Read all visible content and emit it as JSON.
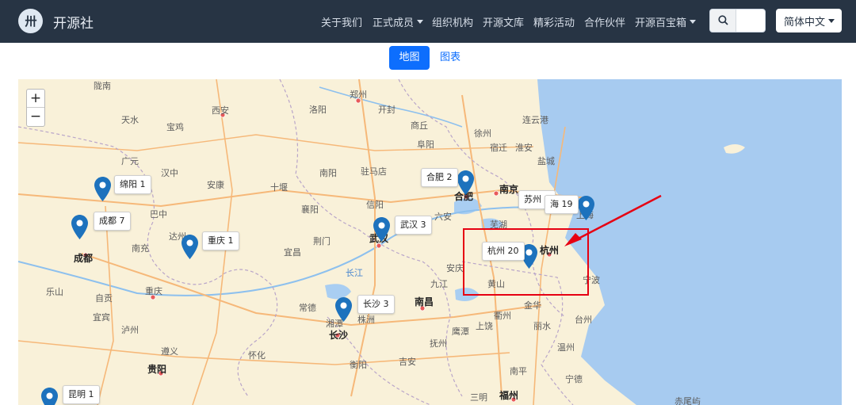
{
  "header": {
    "brand": "开源社",
    "nav": [
      {
        "label": "关于我们",
        "dropdown": false
      },
      {
        "label": "正式成员",
        "dropdown": true
      },
      {
        "label": "组织机构",
        "dropdown": false
      },
      {
        "label": "开源文库",
        "dropdown": false
      },
      {
        "label": "精彩活动",
        "dropdown": false
      },
      {
        "label": "合作伙伴",
        "dropdown": false
      },
      {
        "label": "开源百宝箱",
        "dropdown": true
      }
    ],
    "search_icon": "search-icon",
    "search_value": "",
    "language": "简体中文"
  },
  "tabs": {
    "map": "地图",
    "chart": "图表",
    "active": "地图"
  },
  "map": {
    "zoom_in": "+",
    "zoom_out": "−",
    "colors": {
      "land": "#f9f1d9",
      "sea": "#a7cbf0",
      "marker": "#1d72bd",
      "annotation": "#e60012"
    },
    "place_labels": [
      {
        "text": "西安",
        "major": false
      },
      {
        "text": "郑州",
        "major": false
      },
      {
        "text": "成都",
        "major": true
      },
      {
        "text": "重庆",
        "major": false
      },
      {
        "text": "武汉",
        "major": true
      },
      {
        "text": "合肥",
        "major": true
      },
      {
        "text": "南京",
        "major": true
      },
      {
        "text": "杭州",
        "major": true
      },
      {
        "text": "南昌",
        "major": true
      },
      {
        "text": "长沙",
        "major": true
      },
      {
        "text": "贵阳",
        "major": true
      },
      {
        "text": "福州",
        "major": true
      },
      {
        "text": "上海",
        "major": false
      },
      {
        "text": "长江",
        "major": false
      },
      {
        "text": "天水",
        "major": false
      },
      {
        "text": "宝鸡",
        "major": false
      },
      {
        "text": "汉中",
        "major": false
      },
      {
        "text": "安康",
        "major": false
      },
      {
        "text": "十堰",
        "major": false
      },
      {
        "text": "襄阳",
        "major": false
      },
      {
        "text": "信阳",
        "major": false
      },
      {
        "text": "荆门",
        "major": false
      },
      {
        "text": "宜昌",
        "major": false
      },
      {
        "text": "岳阳",
        "major": false
      },
      {
        "text": "常德",
        "major": false
      },
      {
        "text": "九江",
        "major": false
      },
      {
        "text": "安庆",
        "major": false
      },
      {
        "text": "芜湖",
        "major": false
      },
      {
        "text": "徐州",
        "major": false
      },
      {
        "text": "连云港",
        "major": false
      },
      {
        "text": "宿迁",
        "major": false
      },
      {
        "text": "淮安",
        "major": false
      },
      {
        "text": "盐城",
        "major": false
      },
      {
        "text": "阜阳",
        "major": false
      },
      {
        "text": "商丘",
        "major": false
      },
      {
        "text": "开封",
        "major": false
      },
      {
        "text": "洛阳",
        "major": false
      },
      {
        "text": "南阳",
        "major": false
      },
      {
        "text": "驻马店",
        "major": false
      },
      {
        "text": "六安",
        "major": false
      },
      {
        "text": "黄山",
        "major": false
      },
      {
        "text": "宁波",
        "major": false
      },
      {
        "text": "台州",
        "major": false
      },
      {
        "text": "温州",
        "major": false
      },
      {
        "text": "丽水",
        "major": false
      },
      {
        "text": "金华",
        "major": false
      },
      {
        "text": "衢州",
        "major": false
      },
      {
        "text": "上饶",
        "major": false
      },
      {
        "text": "鹰潭",
        "major": false
      },
      {
        "text": "抚州",
        "major": false
      },
      {
        "text": "吉安",
        "major": false
      },
      {
        "text": "株洲",
        "major": false
      },
      {
        "text": "湘潭",
        "major": false
      },
      {
        "text": "衡阳",
        "major": false
      },
      {
        "text": "怀化",
        "major": false
      },
      {
        "text": "遵义",
        "major": false
      },
      {
        "text": "泸州",
        "major": false
      },
      {
        "text": "自贡",
        "major": false
      },
      {
        "text": "乐山",
        "major": false
      },
      {
        "text": "宜宾",
        "major": false
      },
      {
        "text": "南充",
        "major": false
      },
      {
        "text": "达州",
        "major": false
      },
      {
        "text": "巴中",
        "major": false
      },
      {
        "text": "广元",
        "major": false
      },
      {
        "text": "陇南",
        "major": false
      },
      {
        "text": "宁德",
        "major": false
      },
      {
        "text": "南平",
        "major": false
      },
      {
        "text": "三明",
        "major": false
      },
      {
        "text": "赤尾屿",
        "major": false
      }
    ],
    "markers": [
      {
        "city": "绵阳",
        "count": 1,
        "label": "绵阳 1"
      },
      {
        "city": "成都",
        "count": 7,
        "label": "成都 7"
      },
      {
        "city": "重庆",
        "count": 1,
        "label": "重庆 1"
      },
      {
        "city": "武汉",
        "count": 3,
        "label": "武汉 3"
      },
      {
        "city": "合肥",
        "count": 2,
        "label": "合肥 2"
      },
      {
        "city": "苏州",
        "count": 2,
        "label": "苏州 2"
      },
      {
        "city": "上海",
        "count": 19,
        "label": "海 19"
      },
      {
        "city": "杭州",
        "count": 20,
        "label": "杭州 20"
      },
      {
        "city": "长沙",
        "count": 3,
        "label": "长沙 3"
      },
      {
        "city": "昆明",
        "count": 1,
        "label": "昆明 1"
      }
    ]
  }
}
